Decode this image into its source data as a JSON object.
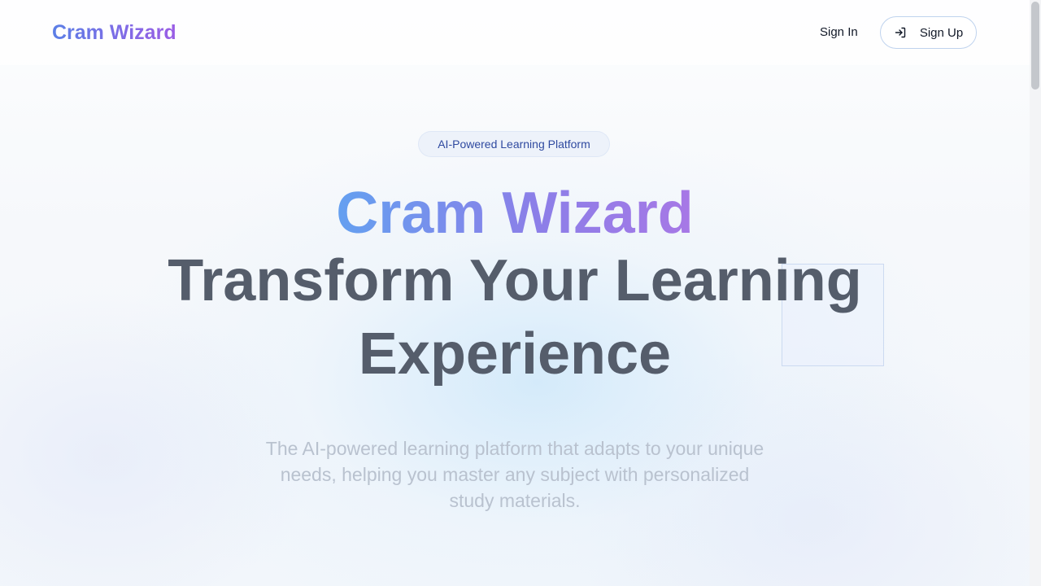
{
  "header": {
    "logo": "Cram Wizard",
    "signin_label": "Sign In",
    "signup_label": "Sign Up",
    "signup_icon": "login-icon"
  },
  "hero": {
    "badge": "AI-Powered Learning Platform",
    "brand": "Cram Wizard",
    "title_line1": "Transform Your Learning",
    "title_line2": "Experience",
    "subtitle": "The AI-powered learning platform that adapts to your unique needs, helping you master any subject with personalized study materials."
  },
  "colors": {
    "brand_gradient_start": "#5b7fe6",
    "brand_gradient_end": "#9b5de5",
    "heading": "#555d6b",
    "subtitle": "#b9c2cf",
    "badge_text": "#2f4aa0"
  }
}
